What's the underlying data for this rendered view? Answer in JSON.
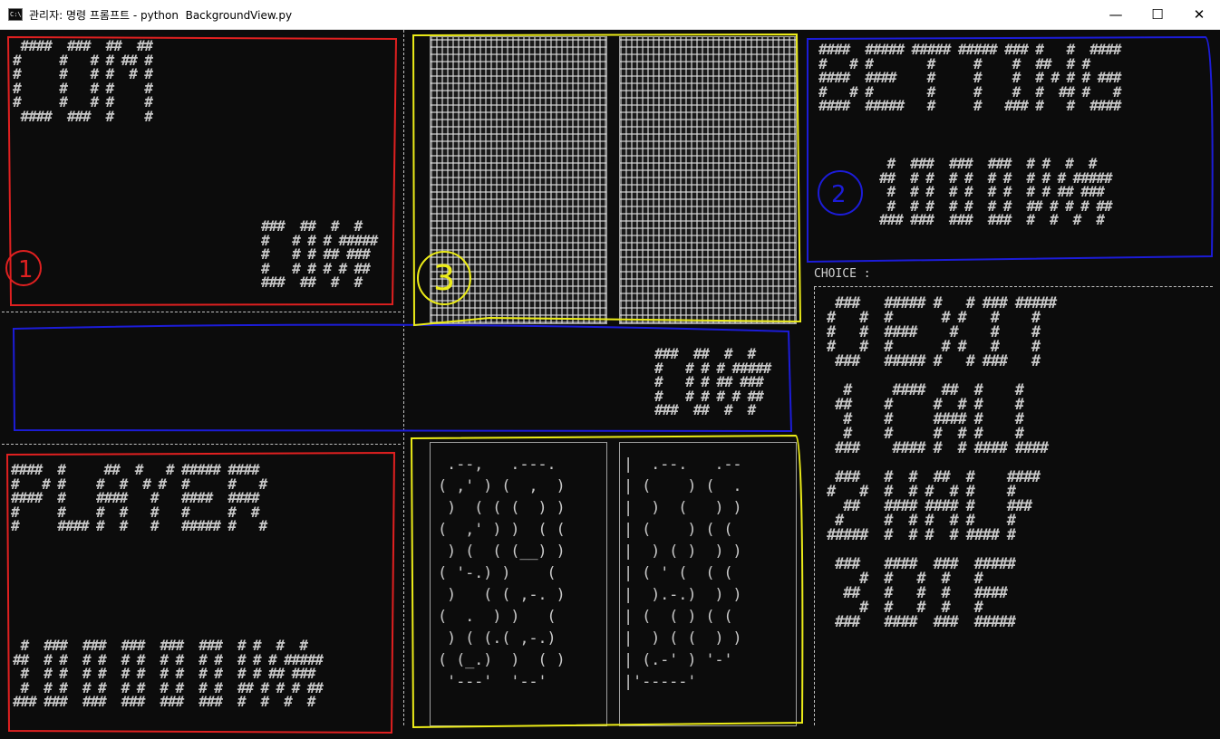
{
  "window": {
    "icon_text": "C:\\",
    "title": "관리자: 명령 프롬프트 - python  BackgroundView.py",
    "minimize_glyph": "—",
    "maximize_glyph": "☐",
    "close_glyph": "✕"
  },
  "computer": {
    "name_art": " ####  ###  ##  ##\n#     #   # # ## #\n#     #   # #  # #\n#     #   # #    #\n#     #   # #    #\n ####  ###  #    #",
    "money_art": "###  ##  #  #\n#   # # # #####\n#   # # ## ###\n#   # # # # ##\n###  ##  #  #"
  },
  "pot": {
    "money_art": "###  ##  #  #\n#   # # # #####\n#   # # ## ###\n#   # # # # ##\n###  ##  #  #"
  },
  "player": {
    "name_art": "####  #     ##  #   # ##### ####\n#   # #    #  #  # #  #     #   #\n####  #    ####   #   ####  ####\n#     #    #  #   #   #     #  #\n#     #### #  #   #   ##### #   #",
    "money_art": " #  ###  ###  ###  ###  ###  # #  #  #\n##  # #  # #  # #  # #  # #  # # # #####\n #  # #  # #  # #  # #  # #  # # ## ###\n #  # #  # #  # #  # #  # #  ## # # # ##\n### ###  ###  ###  ###  ###  #  #  #  #"
  },
  "betting": {
    "label_art": "####  ##### ##### ##### ### #   #  ####\n#   # #       #     #    #  ##  # #\n####  ####    #     #    #  # # # # ###\n#   # #       #     #    #  #  ## #   #\n####  #####   #     #   ### #   #  ####",
    "amount_art": " #  ###  ###  ###  # #  #  #\n##  # #  # #  # #  # # # #####\n #  # #  # #  # #  # # ## ###\n #  # #  # #  # #  ## # # # ##\n### ###  ###  ###  #  #  #  #"
  },
  "menu": {
    "choice_prompt": "CHOICE :",
    "options_art": " ###   ##### #   # ### #####\n#   #  #      # #   #    #\n#   #  ####    #    #    #\n#   #  #      # #   #    #\n ###   ##### #   # ###   #\n\n  #     ####  ##  #    #\n ##    #     #  # #    #\n  #    #     #### #    #\n  #    #     #  # #    #\n ###    #### #  # #### ####\n\n ###   #  #  ##  #    ####\n#   #  #  # #  # #    #\n  ##   #### #### #    ###\n #     #  # #  # #    #\n#####  #  # #  # #### #\n\n ###   ####  ###  #####\n    #  #   #  #   #\n  ##   #   #  #   ####\n    #  #   #  #   #\n ###   ####  ###  #####"
  },
  "com_cards": {
    "count": 2,
    "state": "face-down"
  },
  "player_cards": {
    "left_art": " .--,   .---.\n( ,' ) (  ,  )\n )  ( ( (  ) )\n(  ,' ) )  ( (\n ) (  ( (__) )\n( '-.) )    (\n )   ( ( ,-. )\n(  .  ) )   ( \n ) ( (.( ,-.)\n( (_.)  )  ( )\n '---'  '--'",
    "right_art": "|  .--.   .--\n| (    ) (  .\n|  )  (   ) )\n| (    ) ( (\n|  ) ( )  ) )\n| ( ' (  ( (\n|  ).-.)  ) )\n| (  ( ) ( (\n|  ) ( (  ) )\n| (.-' ) '-'\n|'-----'"
  },
  "annotations": {
    "color_red": "#e02020",
    "color_blue": "#1c1cd8",
    "color_yellow": "#ecec18",
    "labels": [
      "1",
      "2",
      "3"
    ]
  }
}
